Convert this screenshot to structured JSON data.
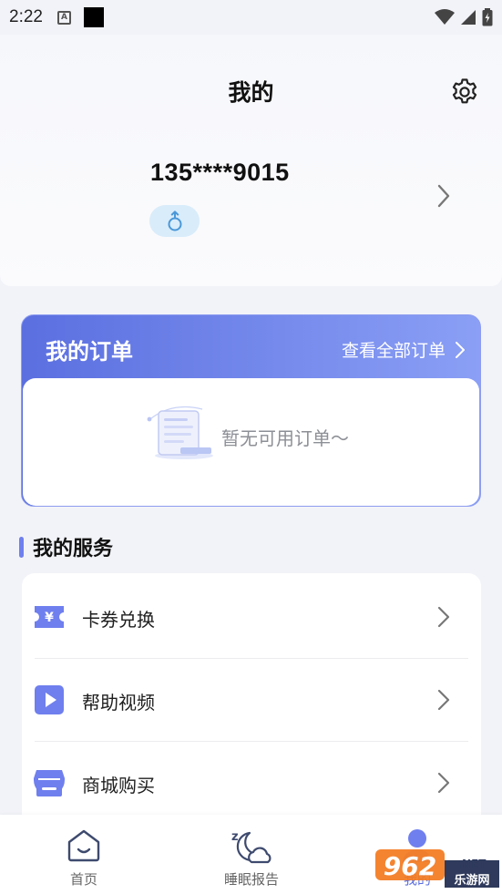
{
  "status_bar": {
    "time": "2:22",
    "a_icon_glyph": "A"
  },
  "header": {
    "title": "我的",
    "phone": "135****9015",
    "gender_symbol": "♂"
  },
  "orders": {
    "title": "我的订单",
    "view_all": "查看全部订单",
    "empty_text": "暂无可用订单～"
  },
  "services": {
    "title": "我的服务",
    "items": [
      {
        "label": "卡券兑换",
        "icon": "coupon-icon"
      },
      {
        "label": "帮助视频",
        "icon": "video-play-icon"
      },
      {
        "label": "商城购买",
        "icon": "shop-icon"
      }
    ]
  },
  "bottom_nav": {
    "items": [
      {
        "label": "首页",
        "icon": "home-icon"
      },
      {
        "label": "睡眠报告",
        "icon": "sleep-report-icon"
      },
      {
        "label": "我的",
        "icon": "profile-icon"
      }
    ]
  },
  "watermark": {
    "brand": "962",
    "suffix": ".NET",
    "site": "乐游网"
  },
  "colors": {
    "accent": "#5b6fe0",
    "accent_light": "#8a9ff5",
    "page_bg": "#f2f3f8",
    "badge_bg": "#d9ecfa"
  }
}
